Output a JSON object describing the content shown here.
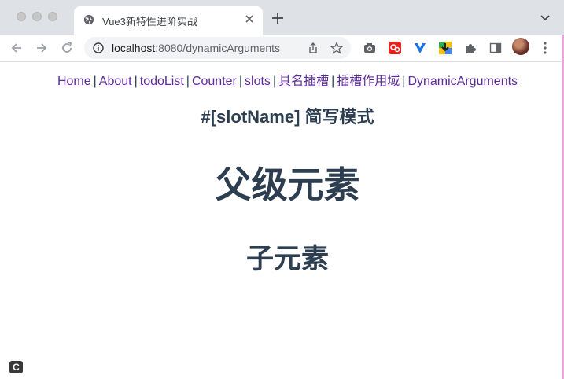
{
  "browser": {
    "tab_title": "Vue3新特性进阶实战",
    "url_host": "localhost",
    "url_rest": ":8080/dynamicArguments"
  },
  "nav": {
    "links": [
      "Home",
      "About",
      "todoList",
      "Counter",
      "slots",
      "具名插槽",
      "插槽作用域",
      "DynamicArguments"
    ],
    "separator": "|"
  },
  "content": {
    "slot_heading": "#[slotName] 简写模式",
    "parent_heading": "父级元素",
    "child_heading": "子元素"
  },
  "extension_badge": "C"
}
